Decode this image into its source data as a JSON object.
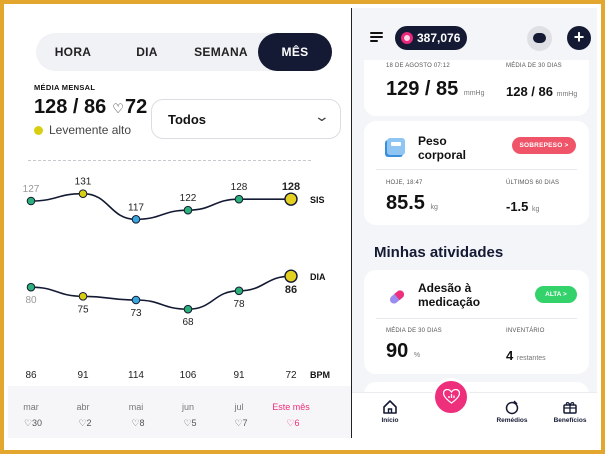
{
  "left": {
    "tabs": [
      {
        "label": "HORA",
        "active": false
      },
      {
        "label": "DIA",
        "active": false
      },
      {
        "label": "SEMANA",
        "active": false
      },
      {
        "label": "MÊS",
        "active": true
      }
    ],
    "avg_label": "MÉDIA MENSAL",
    "avg_sys": "128",
    "avg_sep": " / ",
    "avg_dia": "86",
    "avg_pulse": "72",
    "status_text": "Levemente alto",
    "status_color": "#d8cf12",
    "filter_value": "Todos"
  },
  "chart_data": {
    "type": "line",
    "categories": [
      "mar",
      "abr",
      "mai",
      "jun",
      "jul",
      "Este mês"
    ],
    "series": [
      {
        "name": "SIS",
        "values": [
          127,
          131,
          117,
          122,
          128,
          128
        ]
      },
      {
        "name": "DIA",
        "values": [
          80,
          75,
          73,
          68,
          78,
          86
        ]
      }
    ],
    "bpm": [
      86,
      91,
      114,
      106,
      91,
      72
    ],
    "bpm_label": "BPM",
    "counts": [
      30,
      2,
      8,
      5,
      7,
      6
    ],
    "point_colors": [
      "#2bb07a",
      "#d8cf12",
      "#3aa6de",
      "#2bb07a",
      "#2bb07a",
      "#d8cf12"
    ],
    "ylim": [
      55,
      145
    ]
  },
  "right": {
    "points": "387,076",
    "bp_card": {
      "date_label": "18 DE AGOSTO 07:12",
      "value": "129 / 85",
      "unit": "mmHg",
      "avg_label": "MÉDIA DE 30 DIAS",
      "avg_value": "128 / 86",
      "avg_unit": "mmHg"
    },
    "weight_card": {
      "title_line1": "Peso",
      "title_line2": "corporal",
      "badge": "SOBREPESO >",
      "today_label": "HOJE, 18:47",
      "value": "85.5",
      "unit": "kg",
      "days_label": "ÚLTIMOS 60 DIAS",
      "delta": "-1.5",
      "delta_unit": "kg"
    },
    "section_title": "Minhas atividades",
    "med_card": {
      "title_line1": "Adesão à",
      "title_line2": "medicação",
      "badge": "ALTA >",
      "avg_label": "MÉDIA DE 30 DIAS",
      "value": "90",
      "unit": "%",
      "inv_label": "INVENTÁRIO",
      "inv_value": "4",
      "inv_unit": "restantes"
    },
    "tabbar": {
      "home": "Início",
      "meds": "Remédios",
      "benefits": "Benefícios"
    },
    "colors": {
      "accent": "#ee2f7c",
      "navy": "#141a33",
      "alert": "#f05468",
      "ok": "#34d26b"
    }
  }
}
